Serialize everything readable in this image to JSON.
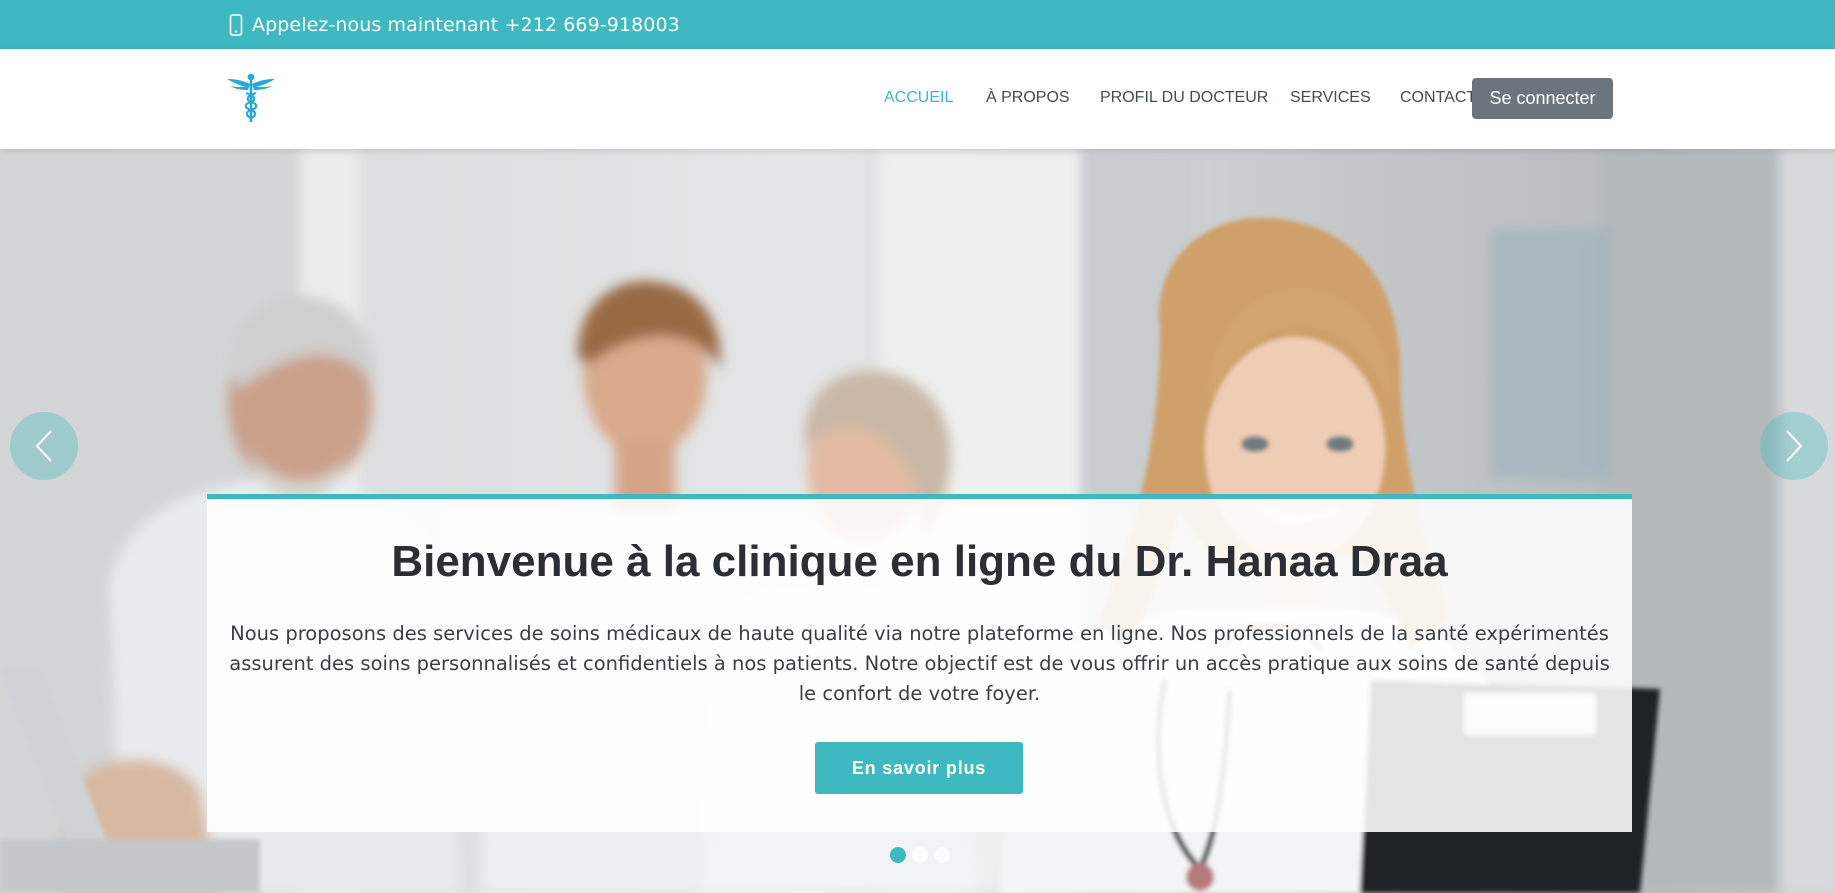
{
  "topbar": {
    "phone_text": "Appelez-nous maintenant +212 669-918003",
    "icon": "phone-icon",
    "background": "#3fb9c1"
  },
  "header": {
    "logo_icon": "caduceus-icon",
    "nav": [
      {
        "label": "ACCUEIL",
        "active": true
      },
      {
        "label": "À PROPOS",
        "active": false
      },
      {
        "label": "PROFIL DU DOCTEUR",
        "active": false
      },
      {
        "label": "SERVICES",
        "active": false
      },
      {
        "label": "CONTACT",
        "active": false
      }
    ],
    "login_label": "Se connecter"
  },
  "hero": {
    "title": "Bienvenue à la clinique en ligne du Dr. Hanaa Draa",
    "text": "Nous proposons des services de soins médicaux de haute qualité via notre plateforme en ligne. Nos professionnels de la santé expérimentés assurent des soins personnalisés et confidentiels à nos patients. Notre objectif est de vous offrir un accès pratique aux soins de santé depuis le confort de votre foyer.",
    "button_label": "En savoir plus",
    "prev_icon": "chevron-left-icon",
    "next_icon": "chevron-right-icon",
    "slides_total": 3,
    "active_slide": 1
  },
  "colors": {
    "accent": "#3fb9c1",
    "nav_text": "#444b52",
    "login_button": "#6c757d",
    "heading": "#2b2f33"
  }
}
